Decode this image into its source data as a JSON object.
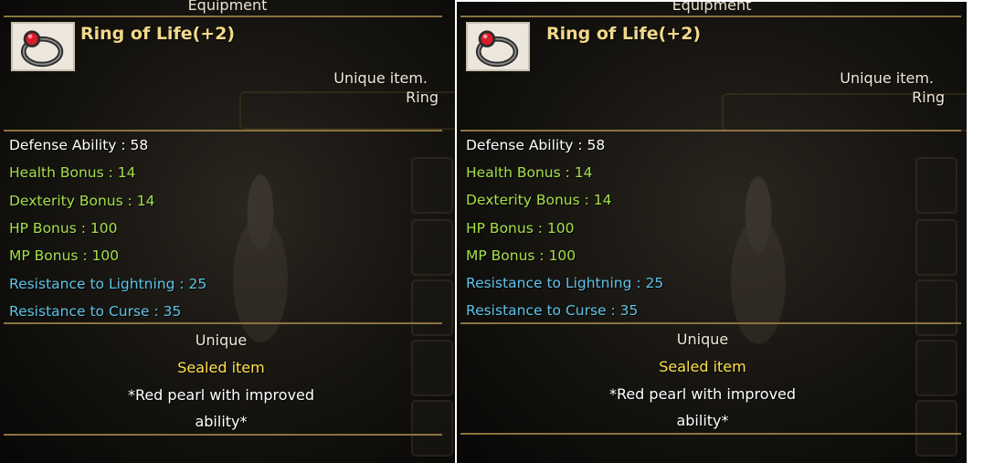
{
  "tooltips": [
    {
      "window_title": "Equipment",
      "item_name": "Ring of Life(+2)",
      "item_class": "Unique item.",
      "item_type": "Ring",
      "stats": [
        {
          "label": "Defense Ability : 58",
          "color": "#ffffff"
        },
        {
          "label": "Health Bonus : 14",
          "color": "#a5e04a"
        },
        {
          "label": "Dexterity Bonus : 14",
          "color": "#a5e04a"
        },
        {
          "label": "HP Bonus : 100",
          "color": "#a5e04a"
        },
        {
          "label": "MP Bonus : 100",
          "color": "#a5e04a"
        },
        {
          "label": "Resistance to Lightning : 25",
          "color": "#5fc4e8"
        },
        {
          "label": "Resistance to Curse : 35",
          "color": "#5fc4e8"
        }
      ],
      "grade": "Unique",
      "sealed": "Sealed item",
      "description_line1": "*Red pearl with improved",
      "description_line2": "ability*"
    },
    {
      "window_title": "Equipment",
      "item_name": "Ring of Life(+2)",
      "item_class": "Unique item.",
      "item_type": "Ring",
      "stats": [
        {
          "label": "Defense Ability : 58",
          "color": "#ffffff"
        },
        {
          "label": "Health Bonus : 14",
          "color": "#a5e04a"
        },
        {
          "label": "Dexterity Bonus : 14",
          "color": "#a5e04a"
        },
        {
          "label": "HP Bonus : 100",
          "color": "#a5e04a"
        },
        {
          "label": "MP Bonus : 100",
          "color": "#a5e04a"
        },
        {
          "label": "Resistance to Lightning : 25",
          "color": "#5fc4e8"
        },
        {
          "label": "Resistance to Curse : 35",
          "color": "#5fc4e8"
        }
      ],
      "grade": "Unique",
      "sealed": "Sealed item",
      "description_line1": "*Red pearl with improved",
      "description_line2": "ability*"
    }
  ],
  "colors": {
    "title_gold": "#f2d98a",
    "white": "#ffffff",
    "green": "#a5e04a",
    "blue": "#5fc4e8",
    "yellow": "#ffe14a",
    "divider": "#8a7340"
  },
  "icons": {
    "item": "ring-icon"
  }
}
